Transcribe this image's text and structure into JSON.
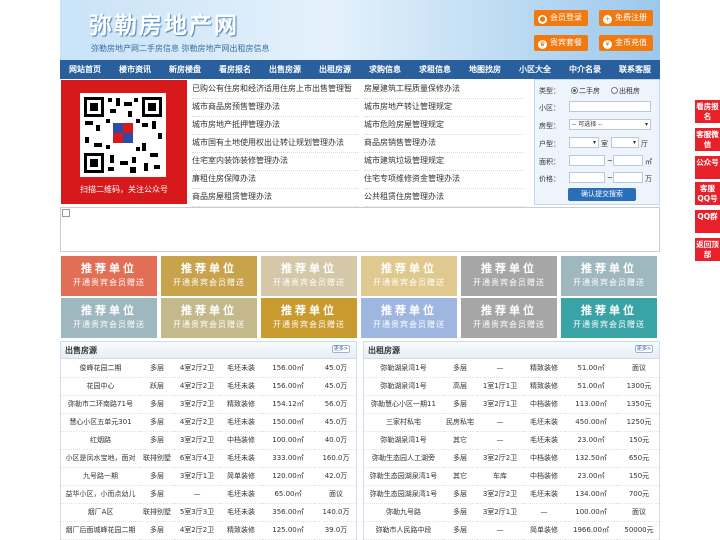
{
  "header": {
    "logo": "弥勒房地产网",
    "slogan": "弥勒房地产网二手房信息  弥勒房地产网出租房信息",
    "buttons": [
      "会员登录",
      "免费注册",
      "贵宾套餐",
      "金币充值"
    ]
  },
  "nav": [
    "网站首页",
    "楼市资讯",
    "新房楼盘",
    "看房报名",
    "出售房源",
    "出租房源",
    "求购信息",
    "求租信息",
    "地图找房",
    "小区大全",
    "中介名录",
    "联系客服"
  ],
  "qr": {
    "caption": "扫描二维码，关注公众号"
  },
  "links": {
    "left": [
      "已购公有住房和经济适用住房上市出售管理暂",
      "城市商品房预售管理办法",
      "城市房地产抵押管理办法",
      "城市国有土地使用权出让转让规划管理办法",
      "住宅室内装饰装修管理办法",
      "廉租住房保障办法",
      "商品房屋租赁管理办法"
    ],
    "right": [
      "房屋建筑工程质量保修办法",
      "城市房地产转让管理规定",
      "城市危险房屋管理规定",
      "商品房销售管理办法",
      "城市建筑垃圾管理规定",
      "住宅专项维修资金管理办法",
      "公共租赁住房管理办法"
    ]
  },
  "search": {
    "type_label": "类型：",
    "type_options": [
      "二手房",
      "出租房"
    ],
    "estate_label": "小区：",
    "house_label": "房型：",
    "house_select": "-- 可选择 --",
    "layout_label": "户型：",
    "room_unit": "室",
    "hall_unit": "厅",
    "area_label": "面积：",
    "area_unit": "㎡",
    "price_label": "价格：",
    "price_unit": "万",
    "range_sep": "~",
    "submit": "确认提交搜索"
  },
  "ads": {
    "line1": "推荐单位",
    "line2": "开通贵宾会员赠送",
    "colors": [
      "#e26f55",
      "#c9a24c",
      "#d4c8a8",
      "#e0c98e",
      "#a6a6a6",
      "#9fb7bf",
      "#9fb7bf",
      "#c4b98a",
      "#c99a2e",
      "#9fb7e0",
      "#a6a6a6",
      "#3aa3a6"
    ]
  },
  "sale": {
    "title": "出售房源",
    "more": "更多>",
    "rows": [
      [
        "俊峰花园二期",
        "多层",
        "4室2厅2卫",
        "毛坯未装",
        "156.00㎡",
        "45.0万"
      ],
      [
        "花园中心",
        "跃层",
        "4室2厅2卫",
        "毛坯未装",
        "156.00㎡",
        "45.0万"
      ],
      [
        "弥勒市二环南路71号",
        "多层",
        "3室2厅2卫",
        "精致装修",
        "154.12㎡",
        "56.0万"
      ],
      [
        "慧心小区五单元301",
        "多层",
        "4室2厅2卫",
        "毛坯未装",
        "150.00㎡",
        "45.0万"
      ],
      [
        "红烟路",
        "多层",
        "3室2厅2卫",
        "中档装修",
        "100.00㎡",
        "40.0万"
      ],
      [
        "小区是凤水宝地，面对",
        "联排别墅",
        "6室3厅4卫",
        "毛坯未装",
        "333.00㎡",
        "160.0万"
      ],
      [
        "九号路一期",
        "多层",
        "3室2厅1卫",
        "简单装修",
        "120.00㎡",
        "42.0万"
      ],
      [
        "益华小区，小而点幼儿",
        "多层",
        "—",
        "毛坯未装",
        "65.00㎡",
        "面议"
      ],
      [
        "烟厂A区",
        "联排别墅",
        "5室3厅3卫",
        "毛坯未装",
        "356.00㎡",
        "140.0万"
      ],
      [
        "烟厂后面城峰花园二期",
        "多层",
        "4室2厅2卫",
        "精致装修",
        "125.00㎡",
        "39.0万"
      ]
    ]
  },
  "rent": {
    "title": "出租房源",
    "more": "更多>",
    "rows": [
      [
        "弥勒湖泉湾1号",
        "多层",
        "—",
        "精致装修",
        "51.00㎡",
        "面议"
      ],
      [
        "弥勒湖泉湾1号",
        "高层",
        "1室1厅1卫",
        "精致装修",
        "51.00㎡",
        "1300元"
      ],
      [
        "弥勒慧心小区一期11",
        "多层",
        "3室2厅1卫",
        "中档装修",
        "113.00㎡",
        "1350元"
      ],
      [
        "三家村私宅",
        "民房私宅",
        "—",
        "毛坯未装",
        "450.00㎡",
        "1250元"
      ],
      [
        "弥勒湖泉湾1号",
        "其它",
        "—",
        "毛坯未装",
        "23.00㎡",
        "150元"
      ],
      [
        "弥勒生态园人工湖旁",
        "多层",
        "3室2厅2卫",
        "中档装修",
        "132.50㎡",
        "650元"
      ],
      [
        "弥勒生态园湖泉湾1号",
        "其它",
        "车库",
        "中档装修",
        "23.00㎡",
        "150元"
      ],
      [
        "弥勒生态园湖泉湾1号",
        "多层",
        "3室2厅2卫",
        "毛坯未装",
        "134.00㎡",
        "700元"
      ],
      [
        "弥勒九号路",
        "多层",
        "3室2厅1卫",
        "—",
        "100.00㎡",
        "面议"
      ],
      [
        "弥勒市人民路中段",
        "多层",
        "—",
        "简单装修",
        "1966.00㎡",
        "50000元"
      ]
    ]
  },
  "side": [
    "看房报名",
    "客服微信",
    "公众号",
    "客服QQ号",
    "QQ群",
    "返回顶部"
  ]
}
